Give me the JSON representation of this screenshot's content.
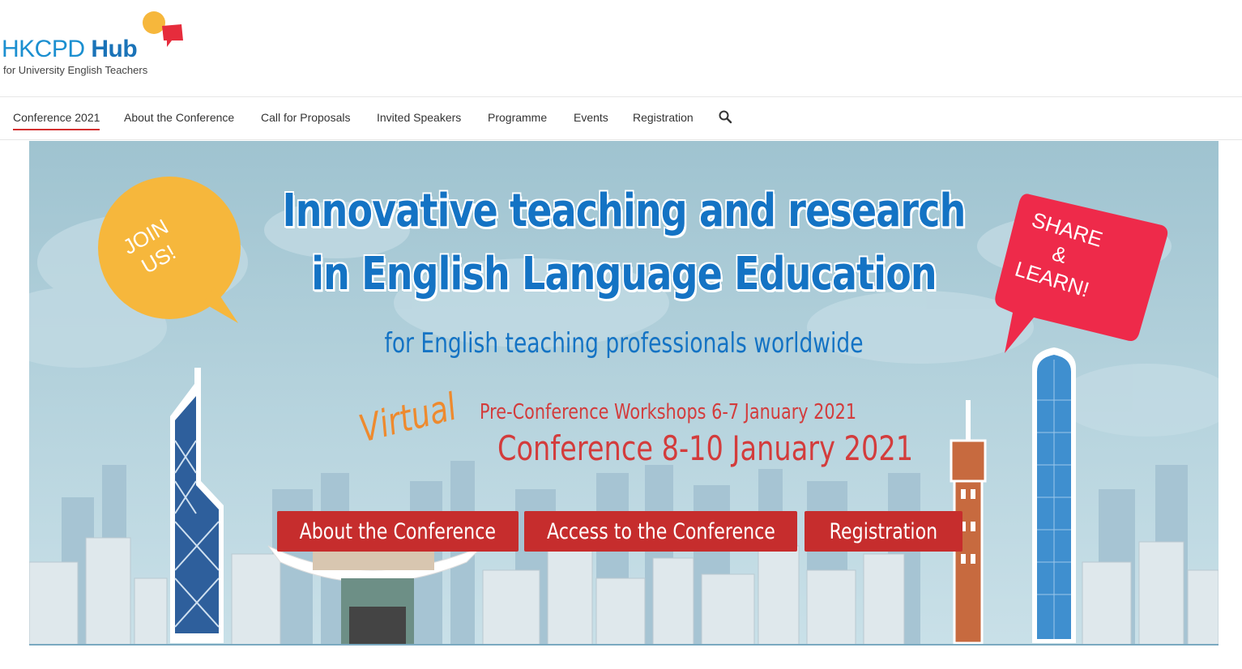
{
  "logo": {
    "main": "HKCPD",
    "hub": "Hub",
    "subtitle": "for University English Teachers"
  },
  "nav": {
    "items": [
      {
        "label": "Conference 2021",
        "active": true
      },
      {
        "label": "About the Conference"
      },
      {
        "label": "Call for Proposals"
      },
      {
        "label": "Invited Speakers"
      },
      {
        "label": "Programme"
      },
      {
        "label": "Events"
      },
      {
        "label": "Registration"
      }
    ],
    "search_icon": "search-icon"
  },
  "banner": {
    "headline_line1": "Innovative teaching and research",
    "headline_line2": "in English Language Education",
    "subline": "for English teaching professionals worldwide",
    "virtual": "Virtual",
    "preconference": "Pre-Conference Workshops 6-7 January 2021",
    "conference": "Conference 8-10 January 2021",
    "join_bubble": "JOIN\nUS!",
    "share_bubble": "SHARE\n&\nLEARN!",
    "buttons": {
      "about": "About the Conference",
      "access": "Access to the Conference",
      "registration": "Registration"
    },
    "colors": {
      "headline": "#1473c4",
      "accent_red": "#c62d2d",
      "virtual_orange": "#ee8a2e",
      "join_bubble": "#f6b73c",
      "share_bubble": "#ee2a4a"
    }
  }
}
